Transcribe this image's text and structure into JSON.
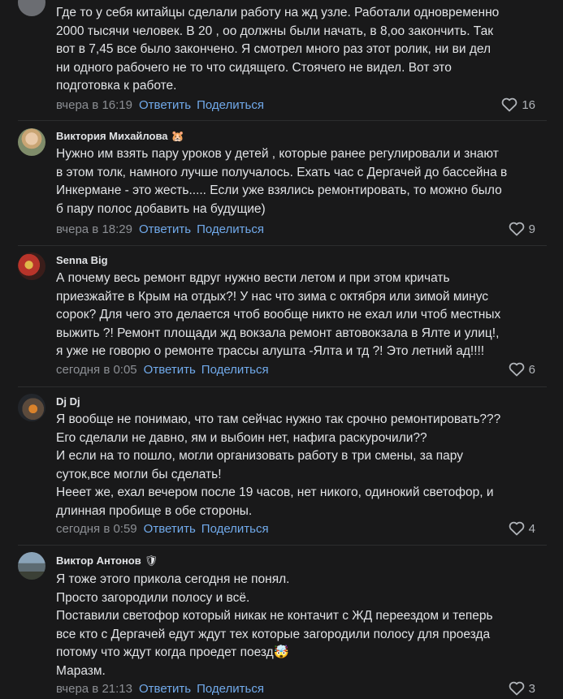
{
  "comments": [
    {
      "author": "",
      "author_emoji": "",
      "lines": [
        "Где то у себя китайцы сделали работу на жд узле. Работали одновременно",
        "2000 тысячи человек. В 20 , оо должны были начать, в 8,оо закончить. Так",
        "вот в 7,45 все было закончено. Я смотрел много раз этот ролик, ни ви дел",
        "ни одного рабочего не то что сидящего. Стоячего не видел. Вот это",
        "подготовка к работе."
      ],
      "time": "вчера в 16:19",
      "reply": "Ответить",
      "share": "Поделиться",
      "likes": "16"
    },
    {
      "author": "Виктория Михайлова",
      "author_emoji": "🐹",
      "lines": [
        "Нужно им взять пару уроков у детей , которые ранее регулировали и знают",
        "в этом толк, намного лучше получалось. Ехать час с Дергачей до бассейна в",
        "Инкермане - это жесть..... Если уже взялись ремонтировать, то можно было",
        "б пару полос добавить на будущие)"
      ],
      "time": "вчера в 18:29",
      "reply": "Ответить",
      "share": "Поделиться",
      "likes": "9"
    },
    {
      "author": "Senna Big",
      "author_emoji": "",
      "lines": [
        "А почему весь ремонт вдруг нужно вести летом и при этом кричать",
        "приезжайте в Крым на отдых?! У нас что зима с октября или зимой минус",
        "сорок? Для чего это делается чтоб вообще никто не ехал или чтоб местных",
        "выжить ?! Ремонт площади жд вокзала ремонт автовокзала в Ялте и улиц!,",
        "я уже не говорю о ремонте трассы алушта -Ялта и тд ?! Это летний ад!!!!"
      ],
      "time": "сегодня в 0:05",
      "reply": "Ответить",
      "share": "Поделиться",
      "likes": "6"
    },
    {
      "author": "Dj Dj",
      "author_emoji": "",
      "lines": [
        "Я вообще не понимаю, что там сейчас нужно так срочно ремонтировать???",
        "Его сделали не давно, ям и выбоин нет, нафига раскурочили??",
        "И если на то пошло, могли организовать работу в три смены, за пару",
        "суток,все могли бы сделать!",
        "Нееет же, ехал вечером после 19 часов, нет никого, одинокий светофор, и",
        "длинная пробище в обе стороны."
      ],
      "time": "сегодня в 0:59",
      "reply": "Ответить",
      "share": "Поделиться",
      "likes": "4"
    },
    {
      "author": "Виктор Антонов",
      "author_emoji": "🛡",
      "lines": [
        "Я тоже этого прикола сегодня не понял.",
        "Просто загородили полосу и всё.",
        "Поставили светофор который никак не контачит с ЖД переездом и теперь",
        "все кто с Дергачей едут ждут тех которые загородили полосу для проезда",
        "потому что ждут когда проедет поезд🤯",
        "Маразм."
      ],
      "time": "вчера в 21:13",
      "reply": "Ответить",
      "share": "Поделиться",
      "likes": "3"
    }
  ],
  "colors": {
    "background": "#19191a",
    "text": "#e1e3e6",
    "meta": "#8c8f94",
    "link": "#71aaeb",
    "divider": "#2c2d2e"
  },
  "icons": {
    "like": "heart-outline-icon"
  }
}
